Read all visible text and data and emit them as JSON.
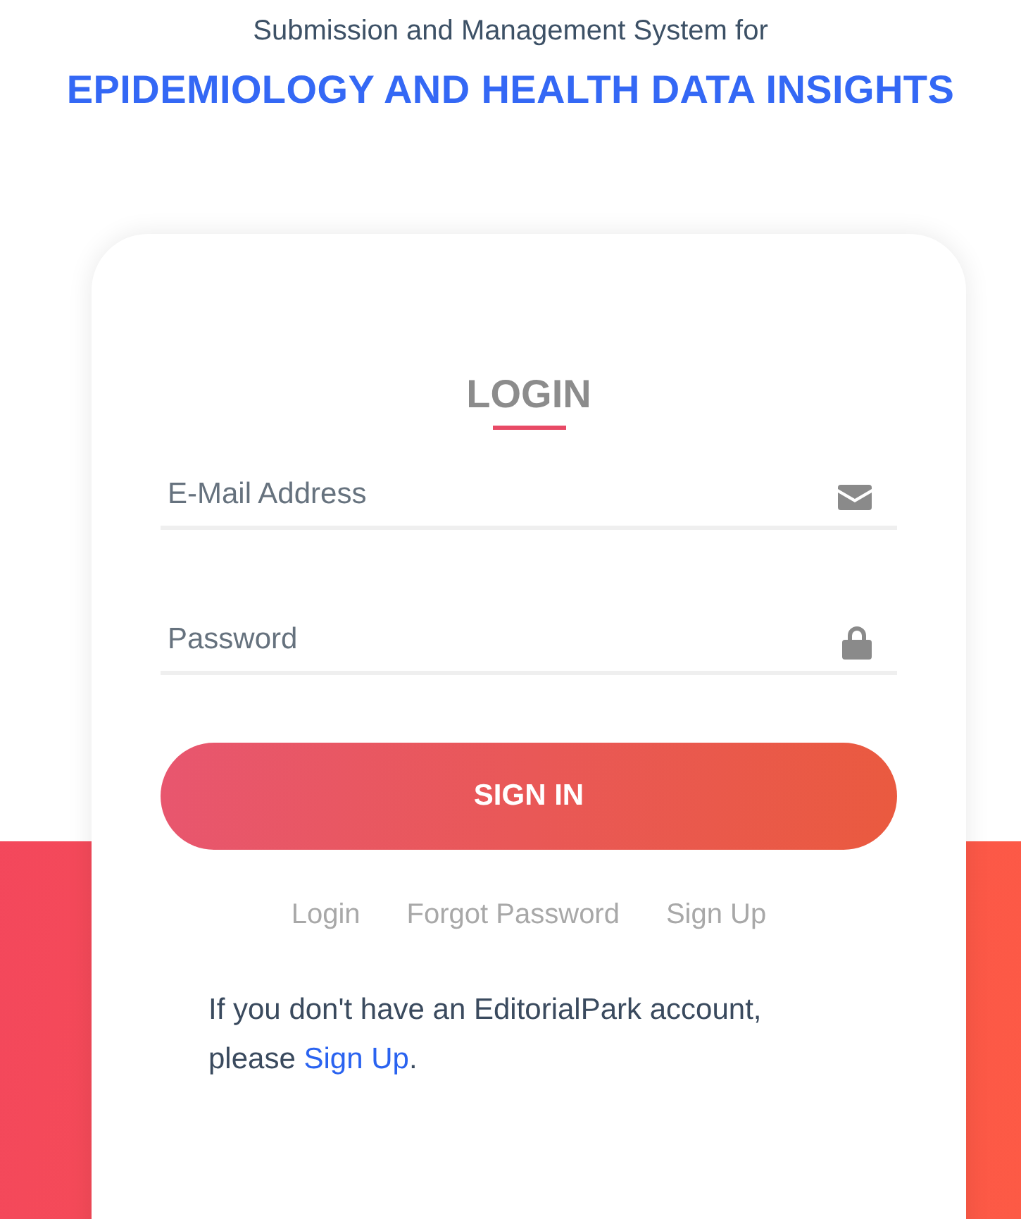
{
  "header": {
    "subtitle": "Submission and Management System for",
    "title": "EPIDEMIOLOGY AND HEALTH DATA INSIGHTS"
  },
  "login": {
    "heading": "LOGIN",
    "fields": [
      {
        "kind": "email",
        "placeholder": "E-Mail Address"
      },
      {
        "kind": "password",
        "placeholder": "Password"
      }
    ],
    "button": "SIGN IN",
    "links": [
      "Login",
      "Forgot Password",
      "Sign Up"
    ],
    "note": {
      "text": "If you don't have an EditorialPark account, please ",
      "link": "Sign Up",
      "end": "."
    }
  }
}
